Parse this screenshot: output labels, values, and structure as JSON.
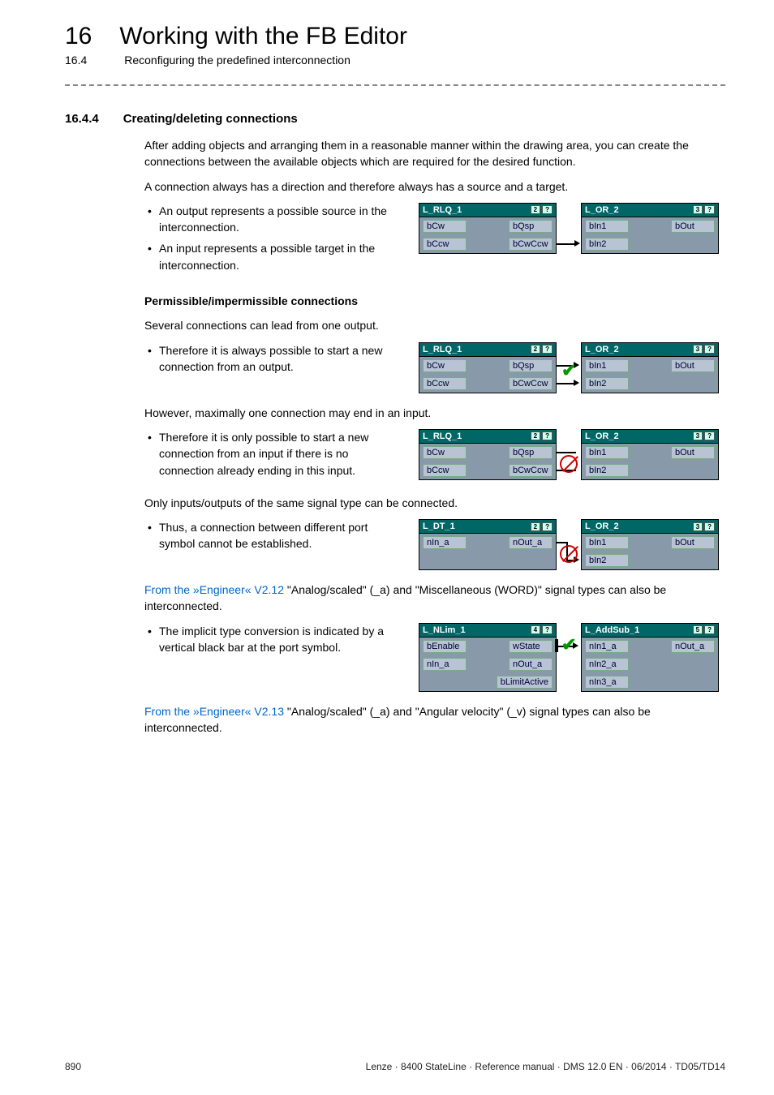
{
  "header": {
    "chapter_num": "16",
    "chapter_title": "Working with the FB Editor",
    "sub_num": "16.4",
    "sub_title": "Reconfiguring the predefined interconnection"
  },
  "section": {
    "num": "16.4.4",
    "title": "Creating/deleting connections"
  },
  "p_intro1": "After adding objects and arranging them in a reasonable manner within the drawing area, you can create the connections between the available objects which are required for the desired function.",
  "p_intro2": "A connection always has a direction and therefore always has a source and a target.",
  "bul1a": "An output represents a possible source in the interconnection.",
  "bul1b": "An input represents a possible target in the interconnection.",
  "h_perm": "Permissible/impermissible connections",
  "p_perm1": "Several connections can lead from one output.",
  "bul2a": "Therefore it is always possible to start a new connection from an output.",
  "p_perm2": "However, maximally one connection may end in an input.",
  "bul3a": "Therefore it is only possible to start a new connection from an input if there is no connection already ending in this input.",
  "p_sig1": "Only inputs/outputs of the same signal type can be connected.",
  "bul4a": "Thus, a connection between different port symbol cannot be established.",
  "p_note1_pre": "From the »Engineer« V2.12",
  "p_note1_post": " \"Analog/scaled\" (_a) and \"Miscellaneous (WORD)\" signal types can also be interconnected.",
  "bul5a": "The implicit type conversion is indicated by a vertical black bar at the port symbol.",
  "p_note2_pre": "From the »Engineer« V2.13",
  "p_note2_post": " \"Analog/scaled\" (_a) and \"Angular velocity\" (_v) signal types can also be interconnected.",
  "fb_rlq": {
    "title": "L_RLQ_1",
    "badge": "2",
    "r1l": "bCw",
    "r1r": "bQsp",
    "r2l": "bCcw",
    "r2r": "bCwCcw"
  },
  "fb_or": {
    "title": "L_OR_2",
    "badge": "3",
    "r1l": "bIn1",
    "r1r": "bOut",
    "r2l": "bIn2"
  },
  "fb_dt": {
    "title": "L_DT_1",
    "badge": "2",
    "r1l": "nIn_a",
    "r1r": "nOut_a"
  },
  "fb_nlim": {
    "title": "L_NLim_1",
    "badge": "4",
    "r1l": "bEnable",
    "r1r": "wState",
    "r2l": "nIn_a",
    "r2r": "nOut_a",
    "r3r": "bLimitActive"
  },
  "fb_add": {
    "title": "L_AddSub_1",
    "badge": "5",
    "r1l": "nIn1_a",
    "r1r": "nOut_a",
    "r2l": "nIn2_a",
    "r3l": "nIn3_a"
  },
  "footer": {
    "page": "890",
    "doc": "Lenze · 8400 StateLine · Reference manual · DMS 12.0 EN · 06/2014 · TD05/TD14"
  }
}
